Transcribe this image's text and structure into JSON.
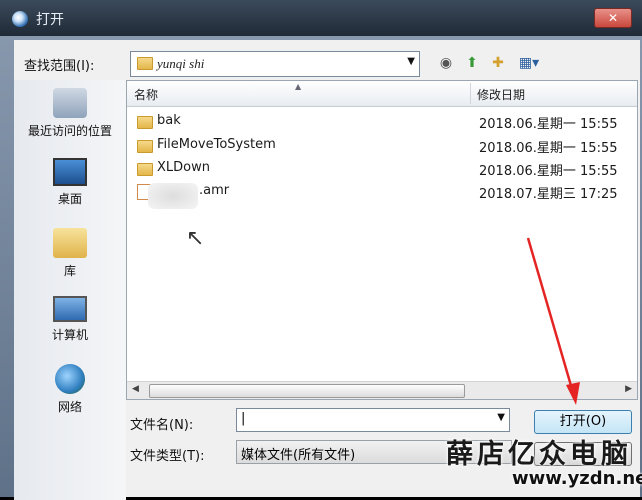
{
  "window": {
    "title": "打开",
    "close_label": "✕"
  },
  "lookin": {
    "label": "查找范围(I):",
    "value": "yunqi shi"
  },
  "places": [
    {
      "label": "最近访问的位置",
      "icon": "recent-places-icon"
    },
    {
      "label": "桌面",
      "icon": "desktop-icon"
    },
    {
      "label": "库",
      "icon": "libraries-icon"
    },
    {
      "label": "计算机",
      "icon": "computer-icon"
    },
    {
      "label": "网络",
      "icon": "network-icon"
    }
  ],
  "file_list": {
    "columns": [
      "名称",
      "修改日期"
    ],
    "rows": [
      {
        "name": "bak",
        "date": "2018.06.星期一 15:55",
        "type": "folder"
      },
      {
        "name": "FileMoveToSystem",
        "date": "2018.06.星期一 15:55",
        "type": "folder"
      },
      {
        "name": "XLDown",
        "date": "2018.06.星期一 15:55",
        "type": "folder"
      },
      {
        "name": ".amr",
        "date": "2018.07.星期三 17:25",
        "type": "file"
      }
    ]
  },
  "filename": {
    "label": "文件名(N):",
    "value": "|"
  },
  "filetype": {
    "label": "文件类型(T):",
    "value": "媒体文件(所有文件)"
  },
  "buttons": {
    "open": "打开(O)"
  },
  "watermark": {
    "cn": "薛店亿众电脑",
    "url": "www.yzdn.net"
  }
}
